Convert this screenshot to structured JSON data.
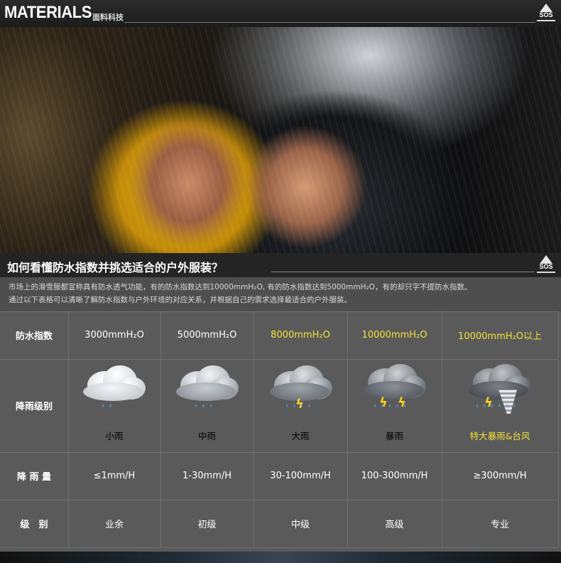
{
  "header": {
    "title": "MATERIALS",
    "subtitle": "面料科技",
    "logo_text": "SOS"
  },
  "question": {
    "title": "如何看懂防水指数并挑选适合的户外服装？",
    "logo_text": "SOS"
  },
  "intro": {
    "line1": "市场上的滑雪服都宣称具有防水透气功能，有的防水指数达到10000mmH₂O, 有的防水指数达到5000mmH₂O，有的却只字不提防水指数。",
    "line2": "通过以下表格可以清晰了解防水指数与户外环境的对应关系，并根据自己的需求选择最适合的户外服装。"
  },
  "table": {
    "row_labels": {
      "index": "防水指数",
      "level": "降雨级别",
      "amount": "降 雨 量",
      "grade": "级　别"
    },
    "columns": [
      {
        "index": "3000mmH₂O",
        "rain": "小雨",
        "amount": "≤1mm/H",
        "grade": "业余",
        "highlight": false,
        "icon": "light-rain-icon"
      },
      {
        "index": "5000mmH₂O",
        "rain": "中雨",
        "amount": "1-30mm/H",
        "grade": "初级",
        "highlight": false,
        "icon": "moderate-rain-icon"
      },
      {
        "index": "8000mmH₂O",
        "rain": "大雨",
        "amount": "30-100mm/H",
        "grade": "中级",
        "highlight": true,
        "icon": "heavy-rain-icon"
      },
      {
        "index": "10000mmH₂O",
        "rain": "暴雨",
        "amount": "100-300mm/H",
        "grade": "高级",
        "highlight": true,
        "icon": "rainstorm-icon"
      },
      {
        "index": "10000mmH₂O以上",
        "rain": "特大暴雨&台风",
        "amount": "≥300mm/H",
        "grade": "专业",
        "highlight": true,
        "icon": "typhoon-icon"
      }
    ]
  },
  "colors": {
    "highlight_text": "#f3e23a",
    "table_bg": "#5a5a5a",
    "rain_drop": "#4aa3e8"
  }
}
